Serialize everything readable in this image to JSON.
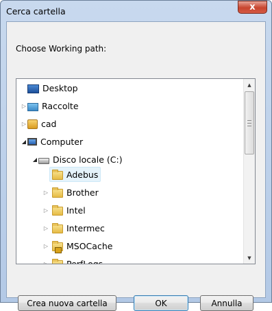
{
  "window": {
    "title": "Cerca cartella",
    "close_glyph": "x"
  },
  "description": "Choose Working path:",
  "tree": {
    "items": [
      {
        "label": "Desktop",
        "icon": "desktop-icon",
        "expander": ""
      },
      {
        "label": "Raccolte",
        "icon": "libraries-icon",
        "expander": "▷"
      },
      {
        "label": "cad",
        "icon": "user-folder-icon",
        "expander": "▷"
      },
      {
        "label": "Computer",
        "icon": "computer-icon",
        "expander": "◢"
      },
      {
        "label": "Disco locale (C:)",
        "icon": "local-disk-icon",
        "expander": "◢"
      },
      {
        "label": "Adebus",
        "icon": "folder-icon",
        "expander": "",
        "selected": true
      },
      {
        "label": "Brother",
        "icon": "folder-icon",
        "expander": "▷"
      },
      {
        "label": "Intel",
        "icon": "folder-icon",
        "expander": "▷"
      },
      {
        "label": "Intermec",
        "icon": "folder-icon",
        "expander": "▷"
      },
      {
        "label": "MSOCache",
        "icon": "locked-folder-icon",
        "expander": "▷"
      },
      {
        "label": "PerfLogs",
        "icon": "folder-icon",
        "expander": "▷"
      }
    ]
  },
  "buttons": {
    "new_folder": "Crea nuova cartella",
    "ok": "OK",
    "cancel": "Annulla"
  },
  "scrollbar": {
    "up_glyph": "▲",
    "down_glyph": "▼"
  }
}
